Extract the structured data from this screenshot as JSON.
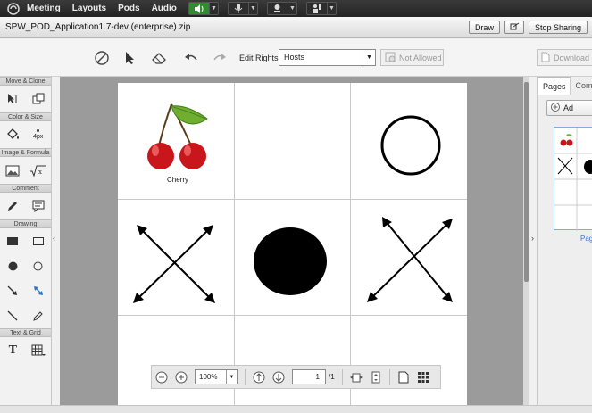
{
  "topbar": {
    "menus": [
      "Meeting",
      "Layouts",
      "Pods",
      "Audio"
    ]
  },
  "titlebar": {
    "filename": "SPW_POD_Application1.7-dev (enterprise).zip",
    "draw_label": "Draw",
    "stop_sharing_label": "Stop Sharing"
  },
  "toolbar": {
    "edit_rights_label": "Edit Rights :",
    "rights_value": "Hosts",
    "not_allowed_label": "Not Allowed",
    "download_label": "Download"
  },
  "palette": {
    "sections": {
      "move": "Move & Clone",
      "color": "Color & Size",
      "image": "Image & Formula",
      "comment": "Comment",
      "drawing": "Drawing",
      "text": "Text & Grid"
    },
    "stroke_size": "4px"
  },
  "canvas": {
    "cherry_label": "Cherry"
  },
  "zoombar": {
    "zoom_value": "100%",
    "page_value": "1",
    "page_total": "/1"
  },
  "rightpanel": {
    "tab_pages": "Pages",
    "tab_comments": "Comm",
    "add_label": "Ad",
    "thumb_label": "Pag"
  },
  "colors": {
    "topbar_bg": "#2b2b2b",
    "audio_active": "#2f8c2f",
    "canvas_bg": "#9b9b9b",
    "link_blue": "#3b74c9"
  }
}
